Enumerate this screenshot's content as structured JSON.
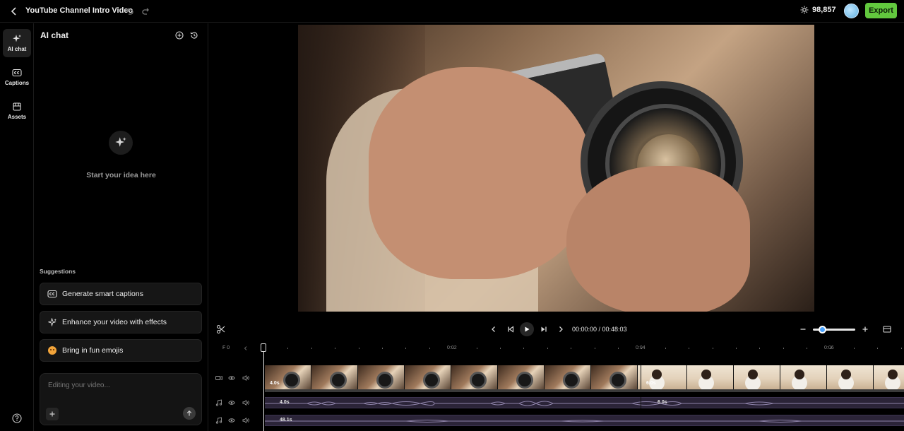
{
  "header": {
    "title": "YouTube Channel Intro Video",
    "credits": "98,857",
    "export_label": "Export"
  },
  "rail": {
    "items": [
      {
        "label": "AI chat",
        "icon": "sparkle-icon",
        "active": true
      },
      {
        "label": "Captions",
        "icon": "captions-icon",
        "active": false
      },
      {
        "label": "Assets",
        "icon": "assets-icon",
        "active": false
      }
    ]
  },
  "chat": {
    "title": "AI chat",
    "empty_text": "Start your idea here",
    "suggestions_title": "Suggestions",
    "suggestions": [
      {
        "label": "Generate smart captions",
        "icon": "captions-icon"
      },
      {
        "label": "Enhance your video with effects",
        "icon": "sparkle-icon"
      },
      {
        "label": "Bring in fun emojis",
        "icon": "emoji-icon"
      }
    ],
    "input_placeholder": "Editing your video..."
  },
  "player": {
    "timecode": "00:00:00 / 00:48:03",
    "zoom_level": 0.2
  },
  "timeline": {
    "frame_label": "F 0",
    "ruler_labels": [
      "0:02",
      "0:04",
      "0:06"
    ],
    "video_clips": [
      {
        "duration": "4.0s"
      },
      {
        "duration": "6.0s"
      }
    ],
    "audio_clips_1": [
      {
        "duration": "4.0s"
      },
      {
        "duration": "6.0s"
      }
    ],
    "audio_clips_2": [
      {
        "duration": "48.1s"
      }
    ]
  },
  "colors": {
    "accent": "#62c83e",
    "audio_track": "#2b2438",
    "zoom_knob": "#4aa3ff"
  }
}
